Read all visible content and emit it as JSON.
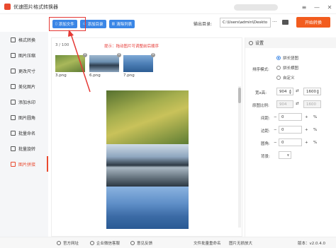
{
  "window": {
    "title": "优速图片格式转换器"
  },
  "toolbar": {
    "add_file": "添加文件",
    "add_folder": "添加目录",
    "clear_list": "清除列表",
    "output_label": "输出目录:",
    "output_path": "C:\\Users\\admin\\Deskto",
    "more": "···",
    "convert": "开始转换"
  },
  "sidebar": {
    "items": [
      {
        "label": "格式转换"
      },
      {
        "label": "图片压缩"
      },
      {
        "label": "更改尺寸"
      },
      {
        "label": "美化图片"
      },
      {
        "label": "添加水印"
      },
      {
        "label": "图片圆角"
      },
      {
        "label": "批量命名"
      },
      {
        "label": "批量旋转"
      },
      {
        "label": "图片拼接"
      }
    ],
    "active_index": 8
  },
  "main": {
    "count": "3 / 100",
    "hint": "提示：拖动图片可调整前后顺序",
    "thumbs": [
      {
        "name": "3.png"
      },
      {
        "name": "6.png"
      },
      {
        "name": "7.png"
      }
    ]
  },
  "settings": {
    "header": "设置",
    "mode_label": "排序模式:",
    "modes": [
      "拼长竖图",
      "拼长横图",
      "自定义"
    ],
    "selected_mode": 0,
    "width_height_label": "宽x高:",
    "width": "904",
    "height": "1600",
    "ratio_label": "原图比例:",
    "ratio_w": "904",
    "ratio_h": "1600",
    "gap_label": "间距:",
    "gap": "0",
    "margin_label": "边距:",
    "margin": "0",
    "radius_label": "圆角:",
    "radius": "0",
    "bg_label": "背景:",
    "percent": "%"
  },
  "statusbar": {
    "website": "官方网址",
    "wechat": "企业微信客服",
    "feedback": "意见反馈",
    "batch_rename": "文件批量重命名",
    "watermark": "图片无损放大",
    "version": "版本：v2.0.4.0"
  },
  "colors": {
    "accent": "#e94a2f",
    "primary": "#3a86e6",
    "convert": "#f25c1e",
    "hint": "#e53935"
  }
}
